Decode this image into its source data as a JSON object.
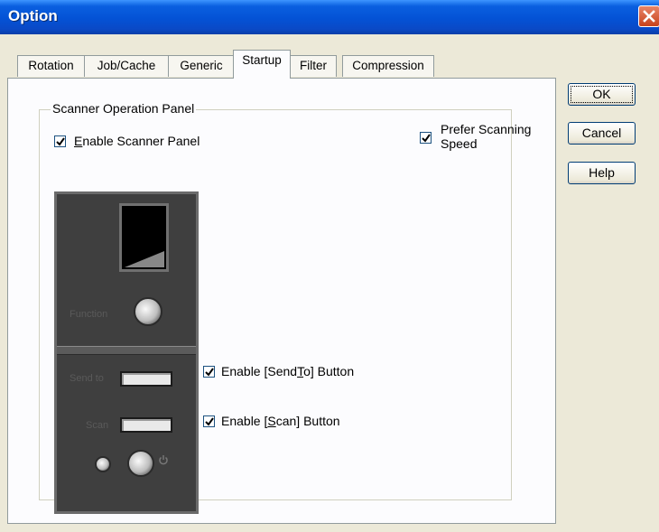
{
  "window": {
    "title": "Option",
    "accent_color": "#0a4fd5",
    "close_color": "#d04c1e"
  },
  "tabs": [
    {
      "label": "Rotation",
      "active": false
    },
    {
      "label": "Job/Cache",
      "active": false
    },
    {
      "label": "Generic",
      "active": false
    },
    {
      "label": "Startup",
      "active": true
    },
    {
      "label": "Filter",
      "active": false
    },
    {
      "label": "Compression",
      "active": false
    }
  ],
  "scanner_panel": {
    "group_label": "Scanner Operation Panel",
    "enable_panel": {
      "prefix": "",
      "accel": "E",
      "suffix": "nable Scanner Panel",
      "checked": true
    },
    "enable_sendto": {
      "prefix": "Enable [Send",
      "accel": "T",
      "suffix": "o] Button",
      "checked": true
    },
    "enable_scan": {
      "prefix": "Enable [",
      "accel": "S",
      "suffix": "can] Button",
      "checked": true
    },
    "device_labels": {
      "function": "Function",
      "send_to": "Send to",
      "scan": "Scan"
    }
  },
  "prefer_speed": {
    "line1": "Prefer Scanning",
    "line2": "Speed",
    "checked": true
  },
  "buttons": {
    "ok": "OK",
    "cancel": "Cancel",
    "help": "Help"
  }
}
